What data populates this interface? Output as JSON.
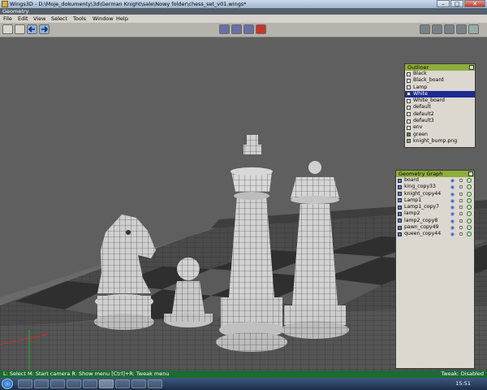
{
  "window": {
    "title": "Wings3D - D:\\Moje_dokumenty\\3d\\German Knight\\sale\\Nowy folder\\chess_set_v01.wings*"
  },
  "mode_tab": {
    "label": "Geometry"
  },
  "menu": {
    "items": [
      "File",
      "Edit",
      "View",
      "Select",
      "Tools",
      "Window",
      "Help"
    ]
  },
  "outliner": {
    "title": "Outliner",
    "items": [
      "Black",
      "Black_board",
      "Lamp",
      "White",
      "White_board",
      "default",
      "default2",
      "default3",
      "env",
      "green",
      "knight_bump.png"
    ],
    "selected": "White"
  },
  "geometry_graph": {
    "title": "Geometry Graph",
    "items": [
      "board",
      "king_copy33",
      "knight_copy44",
      "Lamp1",
      "Lamp1_copy7",
      "lamp2",
      "lamp2_copy8",
      "pawn_copy49",
      "queen_copy44"
    ]
  },
  "status": {
    "left": "L: Select   M: Start camera   R: Show menu   [Ctrl]+R: Tweak menu",
    "right": "Tweak: Disabled"
  },
  "taskbar": {
    "time": "15:51"
  },
  "colors": {
    "selection": "#1d2b90",
    "panel_header": "#8fad3a",
    "status_bar": "#1d6a33",
    "active_mode": "#c3362b"
  }
}
